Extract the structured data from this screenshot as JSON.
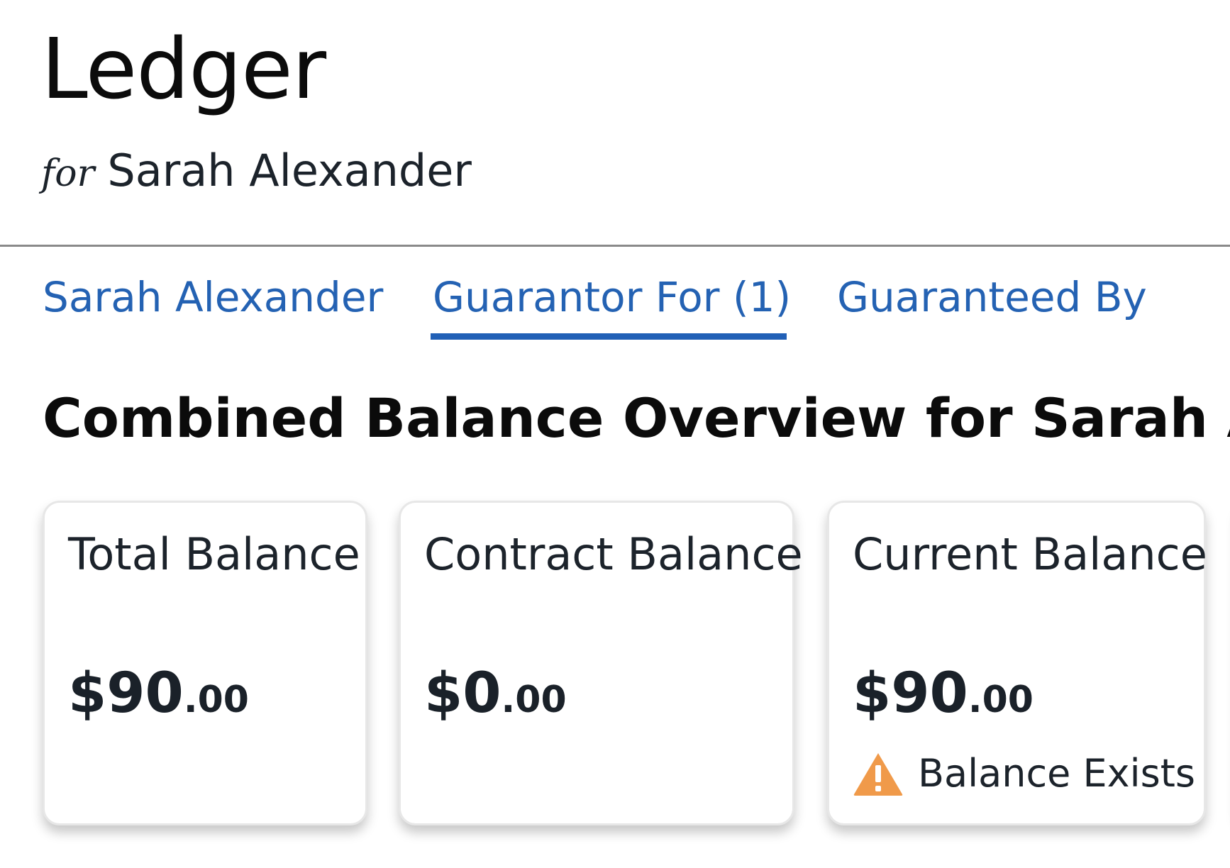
{
  "header": {
    "title": "Ledger",
    "for_word": "for",
    "person_name": "Sarah Alexander"
  },
  "tabs": [
    {
      "label": "Sarah Alexander",
      "active": false
    },
    {
      "label": "Guarantor For (1)",
      "active": true
    },
    {
      "label": "Guaranteed By",
      "active": false
    }
  ],
  "overview": {
    "title": "Combined Balance Overview for Sarah Alexa"
  },
  "cards": [
    {
      "label": "Total Balance",
      "amount_main": "$90",
      "amount_cents": ".00"
    },
    {
      "label": "Contract Balance",
      "amount_main": "$0",
      "amount_cents": ".00"
    },
    {
      "label": "Current Balance",
      "amount_main": "$90",
      "amount_cents": ".00",
      "status": "Balance Exists",
      "status_icon": "warning-icon"
    }
  ],
  "colors": {
    "accent": "#2462b3",
    "warning": "#f09a4a"
  }
}
